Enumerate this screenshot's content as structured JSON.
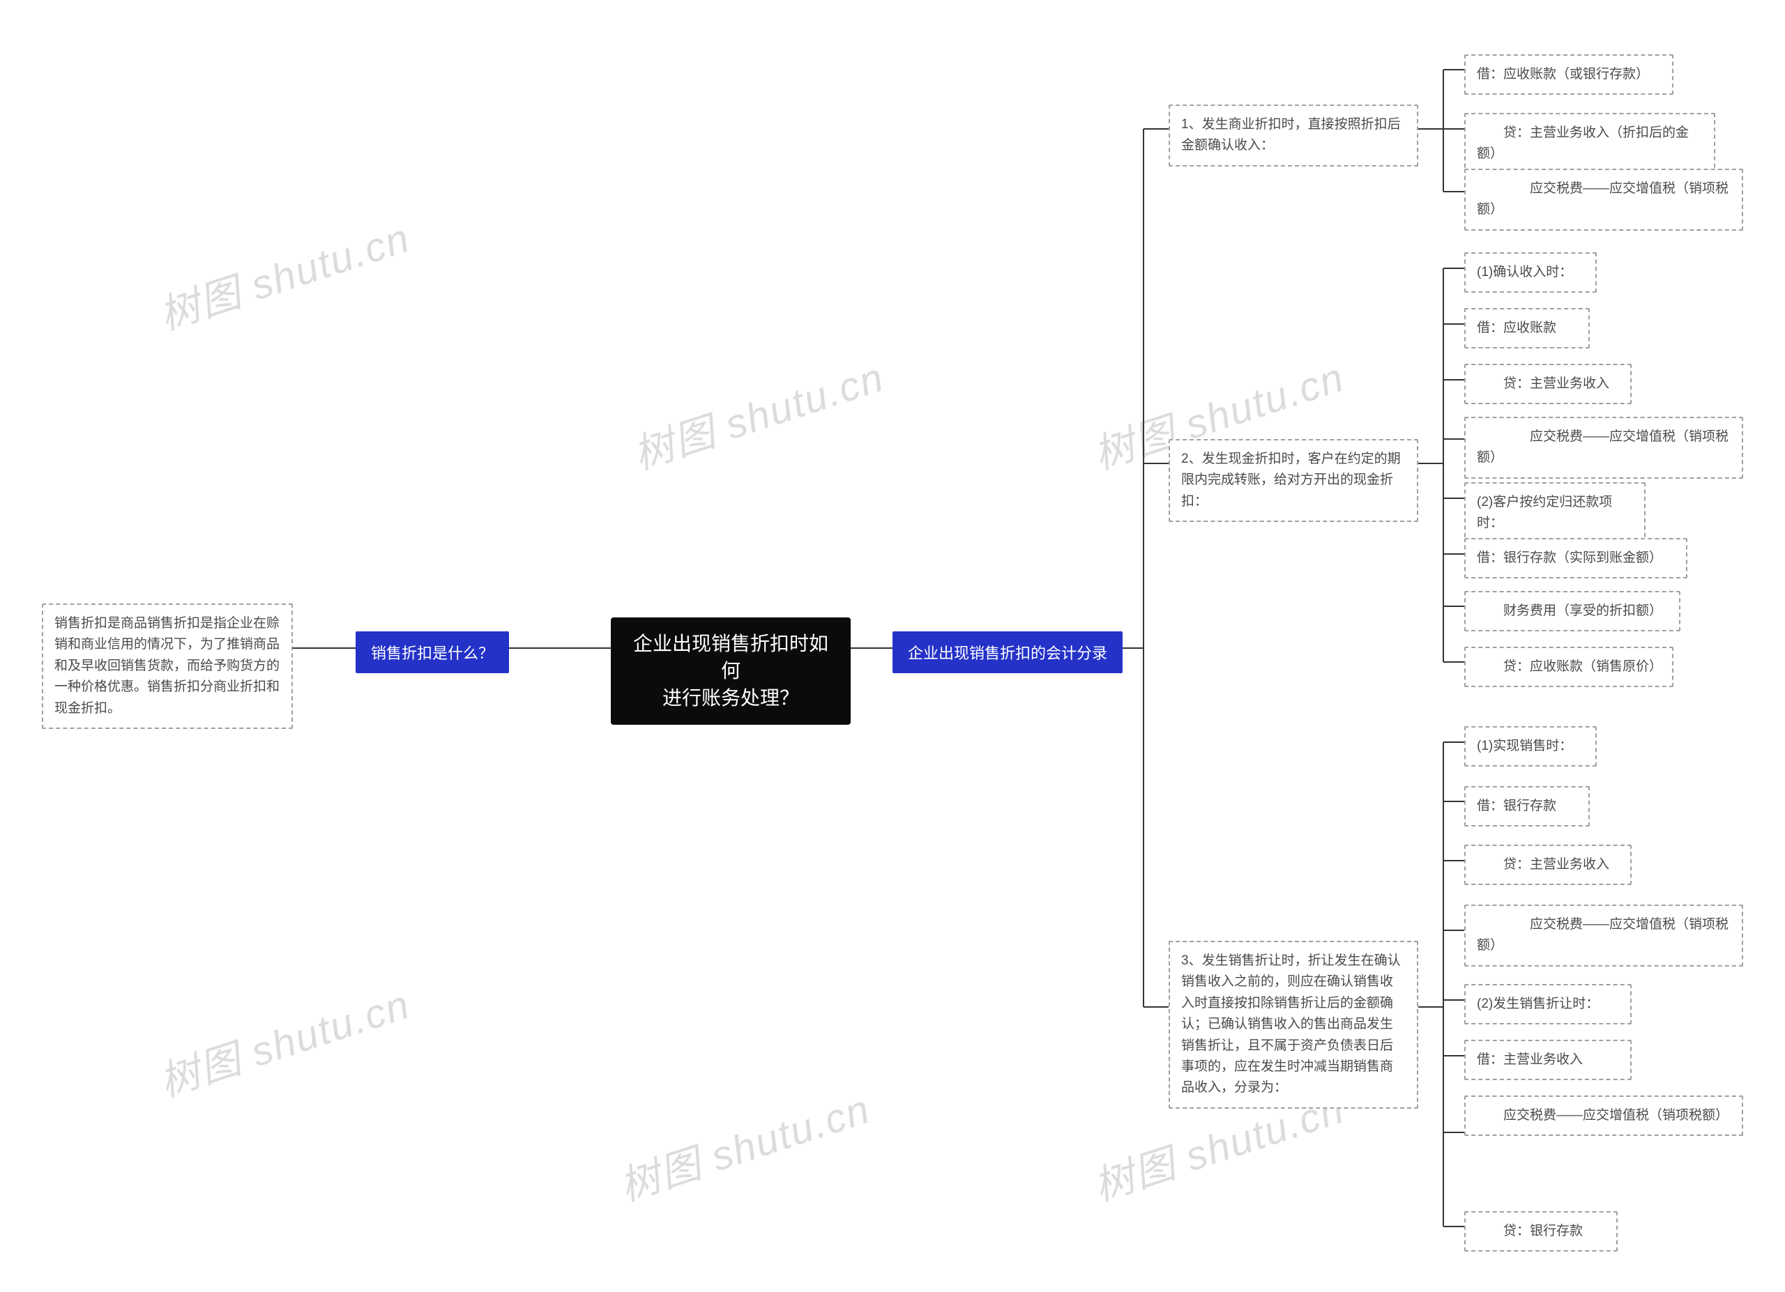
{
  "root": "企业出现销售折扣时如何\n进行账务处理？",
  "left": {
    "what_is": "销售折扣是什么？",
    "what_is_desc": "销售折扣是商品销售折扣是指企业在赊销和商业信用的情况下，为了推销商品和及早收回销售货款，而给予购货方的一种价格优惠。销售折扣分商业折扣和现金折扣。"
  },
  "right": {
    "entries_title": "企业出现销售折扣的会计分录",
    "group1": {
      "title": "1、发生商业折扣时，直接按照折扣后金额确认收入：",
      "items": [
        "借：应收账款（或银行存款）",
        "　　贷：主营业务收入（折扣后的金额）",
        "　　　　应交税费——应交增值税（销项税额）"
      ]
    },
    "group2": {
      "title": "2、发生现金折扣时，客户在约定的期限内完成转账，给对方开出的现金折扣：",
      "items": [
        "(1)确认收入时：",
        "借：应收账款",
        "　　贷：主营业务收入",
        "　　　　应交税费——应交增值税（销项税额）",
        "(2)客户按约定归还款项时：",
        "借：银行存款（实际到账金额）",
        "　　财务费用（享受的折扣额）",
        "　　贷：应收账款（销售原价）"
      ]
    },
    "group3": {
      "title": "3、发生销售折让时，折让发生在确认销售收入之前的，则应在确认销售收入时直接按扣除销售折让后的金额确认；已确认销售收入的售出商品发生销售折让，且不属于资产负债表日后事项的，应在发生时冲减当期销售商品收入，分录为：",
      "items": [
        "(1)实现销售时：",
        "借：银行存款",
        "　　贷：主营业务收入",
        "　　　　应交税费——应交增值税（销项税额）",
        "(2)发生销售折让时：",
        "借：主营业务收入",
        "　　应交税费——应交增值税（销项税额）",
        "　　贷：银行存款"
      ]
    }
  },
  "watermark": "树图 shutu.cn"
}
